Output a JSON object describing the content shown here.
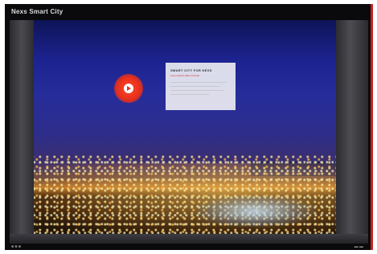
{
  "app": {
    "title": "Nexs Smart City"
  },
  "panel": {
    "title": "SMART CITY FOR NEXS",
    "subtitle": "Lorem ipsum dolor sit amet"
  },
  "hotspot": {
    "icon": "play-icon"
  },
  "colors": {
    "accent": "#e8301a",
    "sky": "#1c2390",
    "frame": "#3a3a40"
  }
}
